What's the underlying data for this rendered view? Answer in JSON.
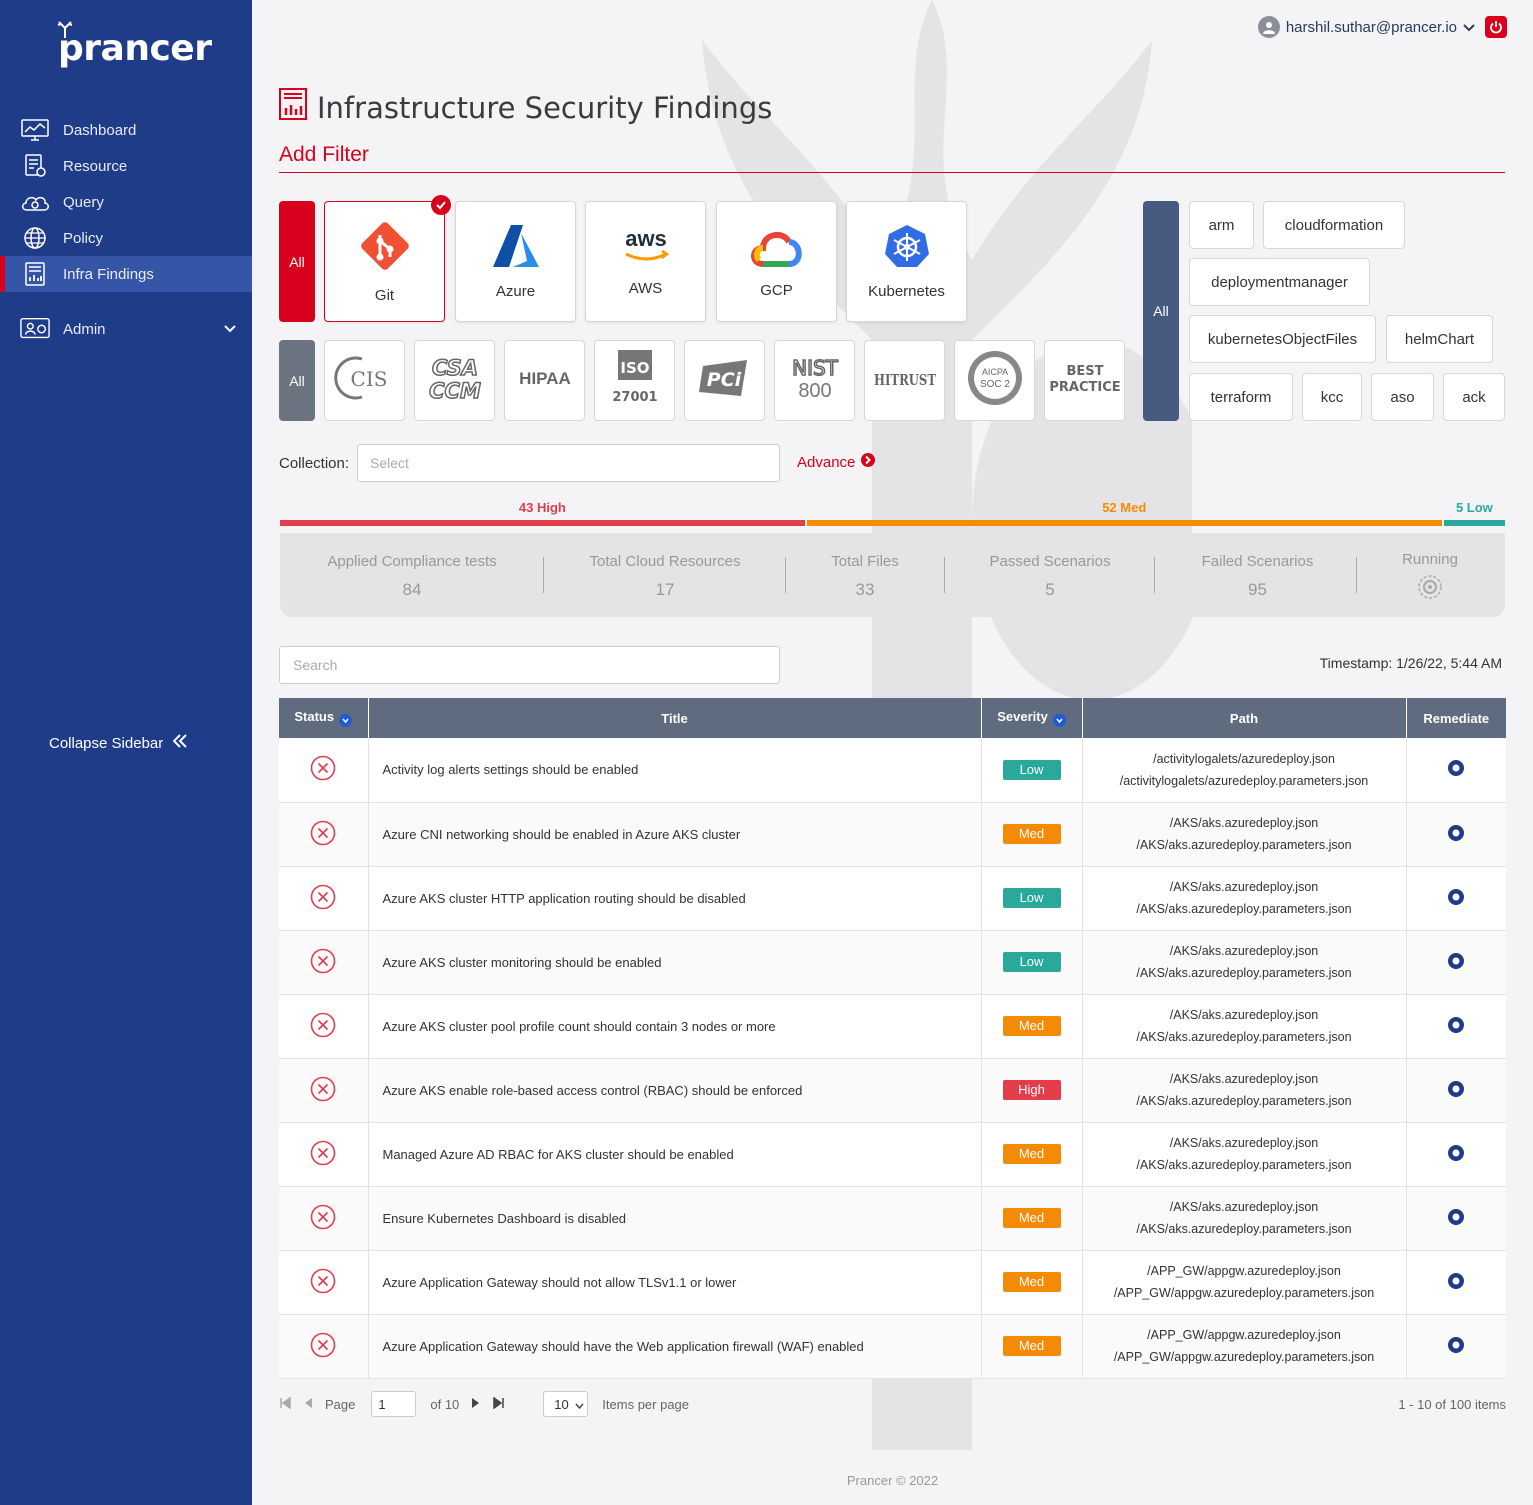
{
  "brand": {
    "name": "prancer"
  },
  "sidebar": {
    "items": [
      {
        "label": "Dashboard",
        "icon": "dashboard-icon"
      },
      {
        "label": "Resource",
        "icon": "resource-icon"
      },
      {
        "label": "Query",
        "icon": "query-cloud-icon"
      },
      {
        "label": "Policy",
        "icon": "policy-globe-icon"
      },
      {
        "label": "Infra Findings",
        "icon": "infra-findings-icon",
        "active": true
      },
      {
        "label": "Admin",
        "icon": "admin-icon"
      }
    ],
    "collapse_label": "Collapse Sidebar"
  },
  "user": {
    "email": "harshil.suthar@prancer.io"
  },
  "page": {
    "title": "Infrastructure Security Findings",
    "add_filter": "Add Filter"
  },
  "providers": {
    "all_label": "All",
    "items": [
      {
        "label": "Git",
        "selected": true
      },
      {
        "label": "Azure"
      },
      {
        "label": "AWS"
      },
      {
        "label": "GCP"
      },
      {
        "label": "Kubernetes"
      }
    ]
  },
  "compliance": {
    "all_label": "All",
    "items": [
      "CIS",
      "CSA CCM",
      "HIPAA",
      "ISO 27001",
      "PCI",
      "NIST 800",
      "HITRUST",
      "AICPA SOC 2",
      "BEST PRACTICE"
    ]
  },
  "templates": {
    "all_label": "All",
    "items": [
      "arm",
      "cloudformation",
      "deploymentmanager",
      "kubernetesObjectFiles",
      "helmChart",
      "terraform",
      "kcc",
      "aso",
      "ack"
    ]
  },
  "collection": {
    "label": "Collection:",
    "placeholder": "Select"
  },
  "advance_label": "Advance",
  "severity_summary": {
    "high": {
      "label": "43 High",
      "count": 43
    },
    "med": {
      "label": "52 Med",
      "count": 52
    },
    "low": {
      "label": "5 Low",
      "count": 5
    }
  },
  "stats": [
    {
      "title": "Applied Compliance tests",
      "value": "84"
    },
    {
      "title": "Total Cloud Resources",
      "value": "17"
    },
    {
      "title": "Total Files",
      "value": "33"
    },
    {
      "title": "Passed Scenarios",
      "value": "5"
    },
    {
      "title": "Failed Scenarios",
      "value": "95"
    },
    {
      "title": "Running",
      "value": ""
    }
  ],
  "search": {
    "placeholder": "Search"
  },
  "timestamp": "Timestamp: 1/26/22, 5:44 AM",
  "table": {
    "headers": {
      "status": "Status",
      "title": "Title",
      "severity": "Severity",
      "path": "Path",
      "remediate": "Remediate"
    },
    "rows": [
      {
        "title": "Activity log alerts settings should be enabled",
        "severity": "Low",
        "path1": "/activitylogalets/azuredeploy.json",
        "path2": "/activitylogalets/azuredeploy.parameters.json"
      },
      {
        "title": "Azure CNI networking should be enabled in Azure AKS cluster",
        "severity": "Med",
        "path1": "/AKS/aks.azuredeploy.json",
        "path2": "/AKS/aks.azuredeploy.parameters.json"
      },
      {
        "title": "Azure AKS cluster HTTP application routing should be disabled",
        "severity": "Low",
        "path1": "/AKS/aks.azuredeploy.json",
        "path2": "/AKS/aks.azuredeploy.parameters.json"
      },
      {
        "title": "Azure AKS cluster monitoring should be enabled",
        "severity": "Low",
        "path1": "/AKS/aks.azuredeploy.json",
        "path2": "/AKS/aks.azuredeploy.parameters.json"
      },
      {
        "title": "Azure AKS cluster pool profile count should contain 3 nodes or more",
        "severity": "Med",
        "path1": "/AKS/aks.azuredeploy.json",
        "path2": "/AKS/aks.azuredeploy.parameters.json"
      },
      {
        "title": "Azure AKS enable role-based access control (RBAC) should be enforced",
        "severity": "High",
        "path1": "/AKS/aks.azuredeploy.json",
        "path2": "/AKS/aks.azuredeploy.parameters.json"
      },
      {
        "title": "Managed Azure AD RBAC for AKS cluster should be enabled",
        "severity": "Med",
        "path1": "/AKS/aks.azuredeploy.json",
        "path2": "/AKS/aks.azuredeploy.parameters.json"
      },
      {
        "title": "Ensure Kubernetes Dashboard is disabled",
        "severity": "Med",
        "path1": "/AKS/aks.azuredeploy.json",
        "path2": "/AKS/aks.azuredeploy.parameters.json"
      },
      {
        "title": "Azure Application Gateway should not allow TLSv1.1 or lower",
        "severity": "Med",
        "path1": "/APP_GW/appgw.azuredeploy.json",
        "path2": "/APP_GW/appgw.azuredeploy.parameters.json"
      },
      {
        "title": "Azure Application Gateway should have the Web application firewall (WAF) enabled",
        "severity": "Med",
        "path1": "/APP_GW/appgw.azuredeploy.json",
        "path2": "/APP_GW/appgw.azuredeploy.parameters.json"
      }
    ]
  },
  "pager": {
    "page_label": "Page",
    "page_value": "1",
    "of_label": "of 10",
    "per_page_value": "10",
    "per_page_label": "Items per page",
    "total": "1 - 10 of 100 items"
  },
  "footer": "Prancer © 2022",
  "colors": {
    "sidebar": "#1f3c88",
    "accent": "#d8001c",
    "high": "#e23d4b",
    "med": "#f58a07",
    "low": "#2aa99a"
  }
}
